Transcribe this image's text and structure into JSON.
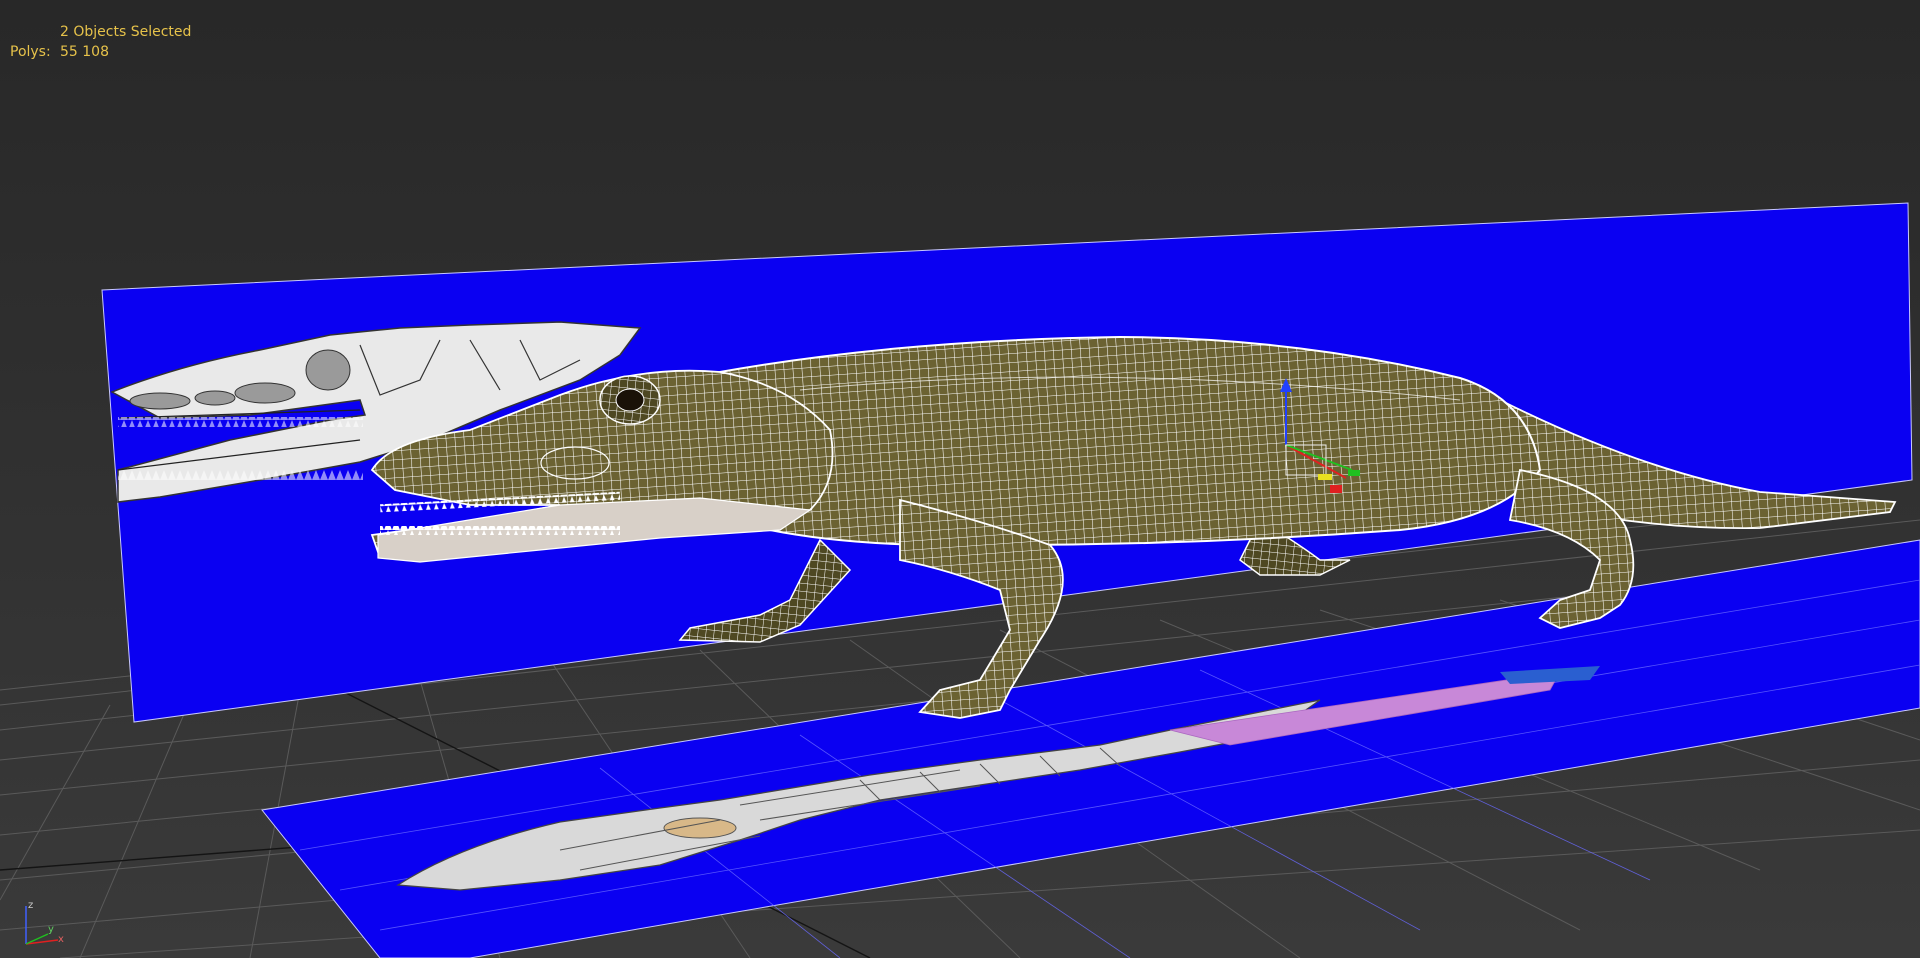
{
  "viewport": {
    "selection_text": "2 Objects Selected",
    "polys_label": "Polys:",
    "polys_value": "55 108",
    "stats_color": "#e6c24a",
    "background_color": "#2b2b2b",
    "reference_plane_color": "#0a00f2",
    "grid_color": "#5a5a5a",
    "wireframe_color": "#ffffff",
    "model_color": "#6b6232"
  },
  "axis_tripod": {
    "z_label": "z",
    "x_label": "x",
    "y_label": "y"
  },
  "gizmo": {
    "x_color": "#e02020",
    "y_color": "#20c020",
    "z_color": "#2040ff",
    "center_color": "#e8e020"
  }
}
